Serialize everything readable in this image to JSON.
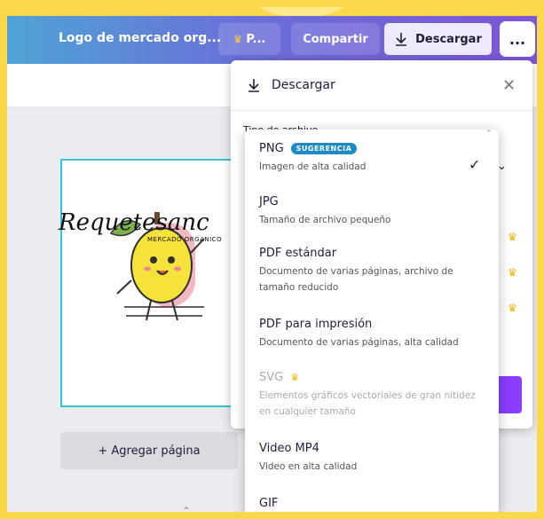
{
  "header": {
    "doc_title": "Logo de mercado org...",
    "premium_label": "P...",
    "share_label": "Compartir",
    "download_label": "Descargar",
    "more_label": "..."
  },
  "editor": {
    "logo_text": "Requetesanc",
    "logo_subtext": "MERCADO ORGANICO",
    "add_page_label": "+ Agregar página"
  },
  "download_panel": {
    "title": "Descargar",
    "file_type_label": "Tipo de archivo"
  },
  "file_options": [
    {
      "title": "PNG",
      "badge": "SUGERENCIA",
      "desc": "Imagen de alta calidad",
      "selected": true
    },
    {
      "title": "JPG",
      "desc": "Tamaño de archivo pequeño"
    },
    {
      "title": "PDF estándar",
      "desc": "Documento de varias páginas, archivo de tamaño reducido"
    },
    {
      "title": "PDF para impresión",
      "desc": "Documento de varias páginas, alta calidad"
    },
    {
      "title": "SVG",
      "desc": "Elementos gráficos vectoriales de gran nitidez en cualquier tamaño",
      "premium": true,
      "disabled": true
    },
    {
      "title": "Video MP4",
      "desc": "Video en alta calidad"
    },
    {
      "title": "GIF",
      "desc": ""
    }
  ],
  "colors": {
    "accent": "#8b3dff",
    "badge": "#1d8bc4",
    "selection": "#33c7d6",
    "crown": "#f0b400"
  }
}
